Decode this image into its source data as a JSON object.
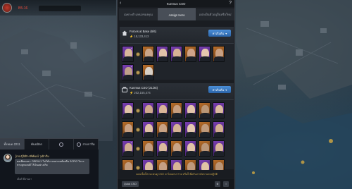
{
  "top_left": {
    "level": "B5-16"
  },
  "chat": {
    "tabs": [
      {
        "label": "ทั้งหมด 2211",
        "icon": "globe-icon"
      },
      {
        "label": "พันธมิตร",
        "icon": ""
      },
      {
        "label": "",
        "icon": "shield-icon"
      },
      {
        "label": "สายการีม",
        "icon": "person-icon"
      }
    ],
    "sender": "[rooJ]นิติกรพิพัฒน์  วุฒิกรีม",
    "message": "ผลเทียบมหา: OREILLY  ไม่ได้มาจนสะดมท้องตีน SCPIO วิหารหาบลูกแตงดี ไร้เงินอย่างเกิด",
    "time": "เมื่อดี ที่ผ่านมา"
  },
  "dialog": {
    "title": "Kunmus CSO",
    "tabs": [
      {
        "label": "เฉพาะตำแหน่งของคุณ",
        "active": false
      },
      {
        "label": "Assign Hero",
        "active": true
      },
      {
        "label": "แปลเป็นตัวอนุอื่นหรือใหม่",
        "active": false
      }
    ],
    "section1": {
      "title": "Forces at Base (6/6)",
      "power": "18,133,413",
      "button": "ค่าเริ่มต้น"
    },
    "section2": {
      "title": "Kunmus CSO (21/25)",
      "power": "202,155,474",
      "button": "ค่าเริ่มต้น"
    },
    "footer_note": "แผ่นเซ็ดก็ตวนะคนดู CSO จะวิ่งบอกบาราย หรือก็เพื่อกันเกามัยกาแถมปฏิบัติ",
    "quick_button": "Quick CSO"
  },
  "colors": {
    "accent_blue": "#2b64a8",
    "rarity_purple": "#7a3fb2",
    "rarity_orange": "#b86e2a",
    "gold_text": "#c7a349"
  }
}
